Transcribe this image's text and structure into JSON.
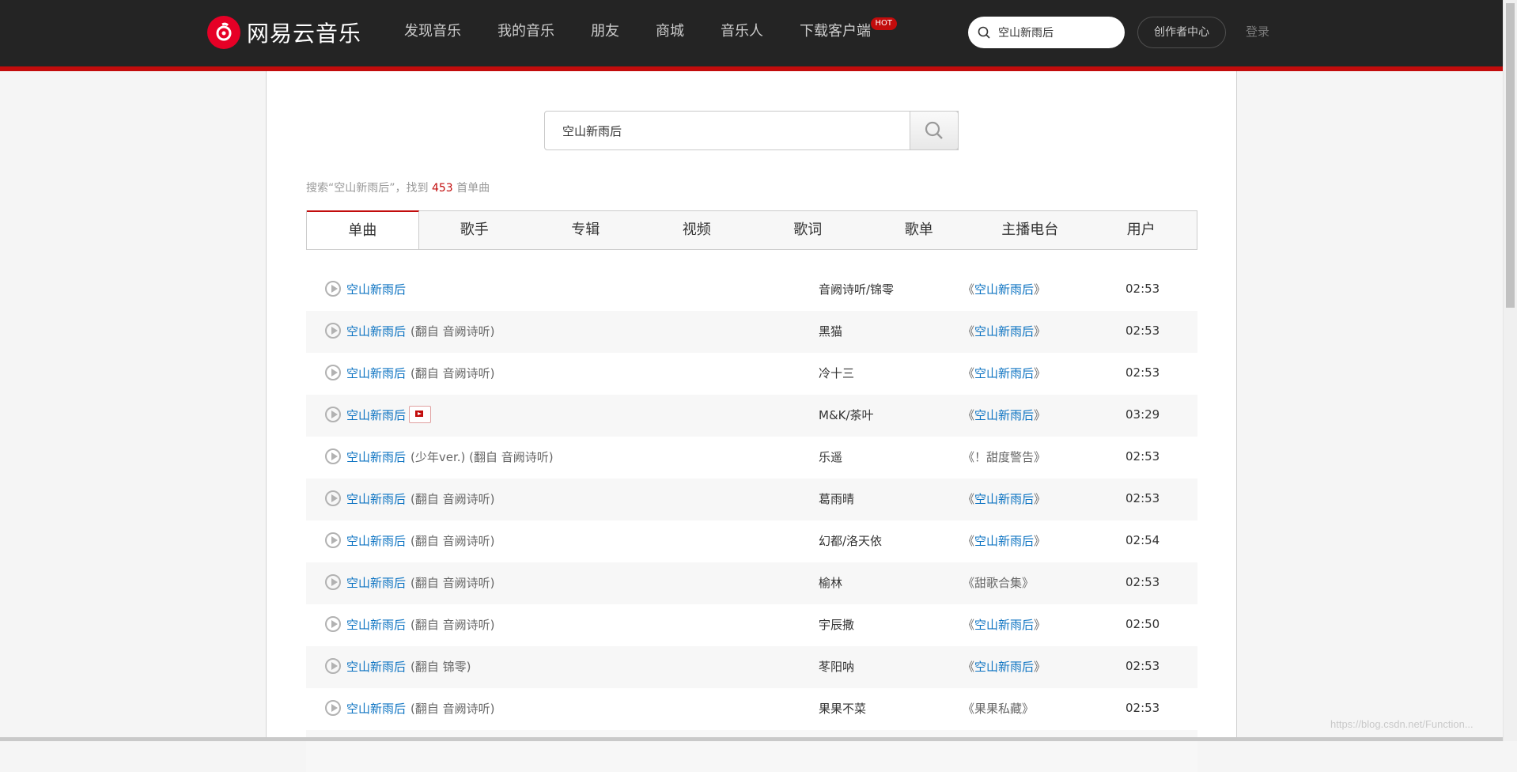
{
  "header": {
    "brand": "网易云音乐",
    "nav": [
      {
        "label": "发现音乐"
      },
      {
        "label": "我的音乐"
      },
      {
        "label": "朋友"
      },
      {
        "label": "商城"
      },
      {
        "label": "音乐人"
      },
      {
        "label": "下载客户端",
        "badge": "HOT"
      }
    ],
    "search_value": "空山新雨后",
    "creator_label": "创作者中心",
    "login_label": "登录"
  },
  "search": {
    "query": "空山新雨后",
    "summary_prefix": "搜索“空山新雨后”，找到",
    "count": "453",
    "summary_suffix": "首单曲"
  },
  "tabs": [
    {
      "label": "单曲",
      "active": true
    },
    {
      "label": "歌手"
    },
    {
      "label": "专辑"
    },
    {
      "label": "视频"
    },
    {
      "label": "歌词"
    },
    {
      "label": "歌单"
    },
    {
      "label": "主播电台"
    },
    {
      "label": "用户"
    }
  ],
  "songs": [
    {
      "title": "空山新雨后",
      "extra": "",
      "mv": false,
      "artist": "音阙诗听/锦零",
      "album_open": "《",
      "album": "空山新雨后",
      "album_close": "》",
      "album_link": true,
      "duration": "02:53"
    },
    {
      "title": "空山新雨后",
      "extra": "(翻自 音阙诗听)",
      "mv": false,
      "artist": "黑猫",
      "album_open": "《",
      "album": "空山新雨后",
      "album_close": "》",
      "album_link": true,
      "duration": "02:53"
    },
    {
      "title": "空山新雨后",
      "extra": "(翻自 音阙诗听)",
      "mv": false,
      "artist": "冷十三",
      "album_open": "《",
      "album": "空山新雨后",
      "album_close": "》",
      "album_link": true,
      "duration": "02:53"
    },
    {
      "title": "空山新雨后",
      "extra": "",
      "mv": true,
      "artist": "M&K/茶叶",
      "album_open": "《",
      "album": "空山新雨后",
      "album_close": "》",
      "album_link": true,
      "duration": "03:29"
    },
    {
      "title": "空山新雨后",
      "extra": "(少年ver.) (翻自 音阙诗听)",
      "mv": false,
      "artist": "乐遥",
      "album_open": "《",
      "album": "！甜度警告",
      "album_close": "》",
      "album_link": false,
      "duration": "02:53"
    },
    {
      "title": "空山新雨后",
      "extra": "(翻自 音阙诗听)",
      "mv": false,
      "artist": "葛雨晴",
      "album_open": "《",
      "album": "空山新雨后",
      "album_close": "》",
      "album_link": true,
      "duration": "02:53"
    },
    {
      "title": "空山新雨后",
      "extra": "(翻自 音阙诗听)",
      "mv": false,
      "artist": "幻都/洛天依",
      "album_open": "《",
      "album": "空山新雨后",
      "album_close": "》",
      "album_link": true,
      "duration": "02:54"
    },
    {
      "title": "空山新雨后",
      "extra": "(翻自 音阙诗听)",
      "mv": false,
      "artist": "榆林",
      "album_open": "《",
      "album": "甜歌合集",
      "album_close": "》",
      "album_link": false,
      "duration": "02:53"
    },
    {
      "title": "空山新雨后",
      "extra": "(翻自 音阙诗听)",
      "mv": false,
      "artist": "宇辰撒",
      "album_open": "《",
      "album": "空山新雨后",
      "album_close": "》",
      "album_link": true,
      "duration": "02:50"
    },
    {
      "title": "空山新雨后",
      "extra": "(翻自 锦零)",
      "mv": false,
      "artist": "苳阳呐",
      "album_open": "《",
      "album": "空山新雨后",
      "album_close": "》",
      "album_link": true,
      "duration": "02:53"
    },
    {
      "title": "空山新雨后",
      "extra": "(翻自 音阙诗听)",
      "mv": false,
      "artist": "果果不菜",
      "album_open": "《",
      "album": "果果私藏",
      "album_close": "》",
      "album_link": false,
      "duration": "02:53"
    }
  ],
  "watermark": "https://blog.csdn.net/Function...",
  "colors": {
    "accent": "#c20c0c",
    "link": "#0c73c2",
    "topbar": "#242424"
  }
}
